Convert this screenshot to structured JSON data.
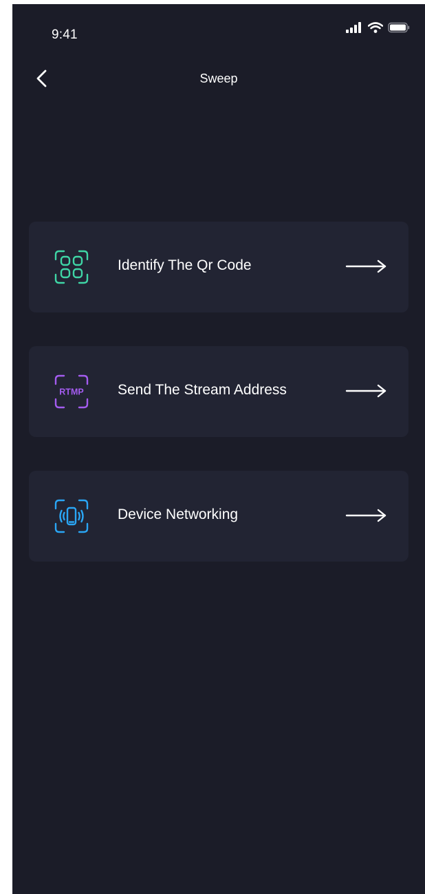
{
  "status_bar": {
    "time": "9:41"
  },
  "nav": {
    "title": "Sweep",
    "back_icon": "chevron-left-icon"
  },
  "menu": {
    "items": [
      {
        "label": "Identify The Qr Code",
        "icon": "qr-scan-icon",
        "icon_color": "#3fd6a6"
      },
      {
        "label": "Send The Stream Address",
        "icon": "rtmp-icon",
        "icon_text": "RTMP",
        "icon_color": "#a45cf0"
      },
      {
        "label": "Device Networking",
        "icon": "device-vibrate-icon",
        "icon_color": "#2aa6f5"
      }
    ]
  },
  "colors": {
    "background": "#1b1c28",
    "card": "#222433",
    "text": "#ffffff"
  }
}
